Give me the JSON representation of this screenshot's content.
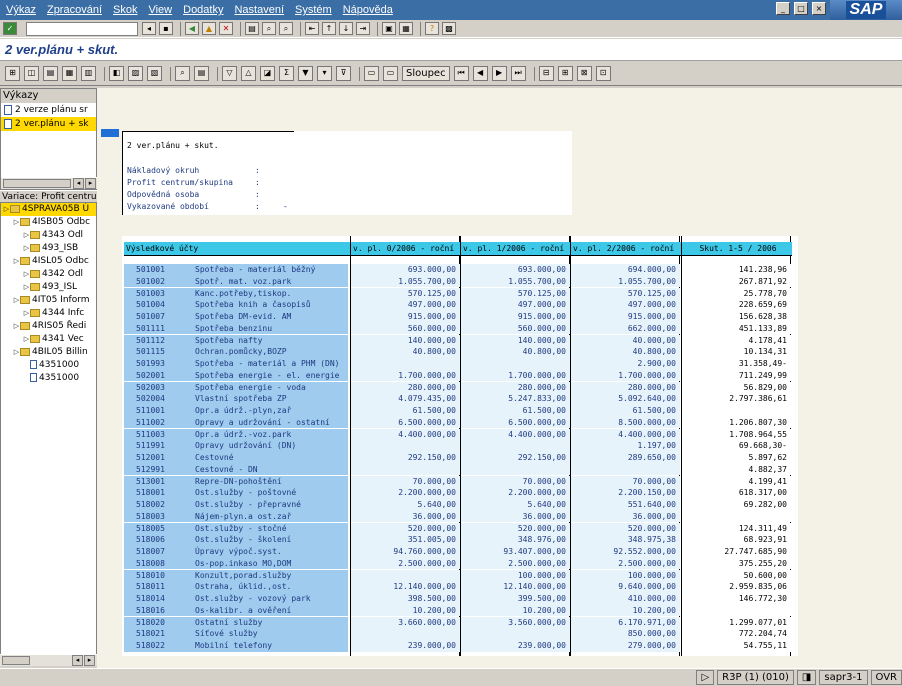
{
  "menu": [
    "Výkaz",
    "Zpracování",
    "Skok",
    "View",
    "Dodatky",
    "Nastavení",
    "Systém",
    "Nápověda"
  ],
  "title": "2 ver.plánu + skut.",
  "app_toolbar": {
    "column_button": "Sloupec"
  },
  "reports_panel": {
    "header": "Výkazy",
    "items": [
      "2 verze plánu sr",
      "2 ver.plánu + sk"
    ]
  },
  "variation_panel": {
    "header": "Variace: Profit centrum",
    "nodes": [
      {
        "label": "4SPRAVA05B Ú",
        "level": 0,
        "type": "folder",
        "sel": true
      },
      {
        "label": "4ISB05 Odbc",
        "level": 1,
        "type": "folder"
      },
      {
        "label": "4343 Odl",
        "level": 2,
        "type": "folder"
      },
      {
        "label": "493_ISB",
        "level": 2,
        "type": "folder"
      },
      {
        "label": "4ISL05 Odbc",
        "level": 1,
        "type": "folder"
      },
      {
        "label": "4342 Odl",
        "level": 2,
        "type": "folder"
      },
      {
        "label": "493_ISL",
        "level": 2,
        "type": "folder"
      },
      {
        "label": "4IT05 Inform",
        "level": 1,
        "type": "folder"
      },
      {
        "label": "4344 Infc",
        "level": 2,
        "type": "folder"
      },
      {
        "label": "4RIS05 Ředi",
        "level": 1,
        "type": "folder"
      },
      {
        "label": "4341 Vec",
        "level": 2,
        "type": "folder"
      },
      {
        "label": "4BIL05 Billin",
        "level": 1,
        "type": "folder"
      },
      {
        "label": "4351000",
        "level": 2,
        "type": "doc"
      },
      {
        "label": "4351000",
        "level": 2,
        "type": "doc"
      }
    ]
  },
  "report_header": {
    "title": "2 ver.plánu + skut.",
    "lines": [
      {
        "label": "Nákladový okruh",
        "colon": ":",
        "value": ""
      },
      {
        "label": "Profit centrum/skupina",
        "colon": ":",
        "value": ""
      },
      {
        "label": "Odpovědná osoba",
        "colon": ":",
        "value": ""
      },
      {
        "label": "Vykazované období",
        "colon": ":",
        "value": "-"
      }
    ]
  },
  "table": {
    "columns": [
      "Výsledkové účty",
      "v. pl. 0/2006 - roční",
      "v. pl. 1/2006 - roční",
      "v. pl. 2/2006 - roční",
      "Skut. 1-5 / 2006"
    ],
    "rows": [
      [
        "501001",
        "Spotřeba - materiál běžný",
        "693.000,00",
        "693.000,00",
        "694.000,00",
        "141.238,96"
      ],
      [
        "501002",
        "Spotř. mat. voz.park",
        "1.055.700,00",
        "1.055.700,00",
        "1.055.700,00",
        "267.871,92"
      ],
      [
        "501003",
        "Kanc.potřeby,tiskop.",
        "570.125,00",
        "570.125,00",
        "570.125,00",
        "25.778,70"
      ],
      [
        "501004",
        "Spotřeba knih a časopisů",
        "497.000,00",
        "497.000,00",
        "497.000,00",
        "228.659,69"
      ],
      [
        "501007",
        "Spotřeba DM-evid. AM",
        "915.000,00",
        "915.000,00",
        "915.000,00",
        "156.628,38"
      ],
      [
        "501111",
        "Spotřeba benzinu",
        "560.000,00",
        "560.000,00",
        "662.000,00",
        "451.133,89"
      ],
      [
        "501112",
        "Spotřeba nafty",
        "140.000,00",
        "140.000,00",
        "40.000,00",
        "4.178,41"
      ],
      [
        "501115",
        "Ochran.pomůcky,BOZP",
        "40.800,00",
        "40.800,00",
        "40.800,00",
        "10.134,31"
      ],
      [
        "501993",
        "Spotřeba - materiál a PHM (DN)",
        "",
        "",
        "2.900,00",
        "31.358,49-"
      ],
      [
        "502001",
        "Spotřeba energie - el. energie",
        "1.700.000,00",
        "1.700.000,00",
        "1.700.000,00",
        "711.249,99"
      ],
      [
        "502003",
        "Spotřeba energie - voda",
        "280.000,00",
        "280.000,00",
        "280.000,00",
        "56.829,00"
      ],
      [
        "502004",
        "Vlastní spotřeba ZP",
        "4.079.435,00",
        "5.247.833,00",
        "5.092.640,00",
        "2.797.386,61"
      ],
      [
        "511001",
        "Opr.a údrž.-plyn,zař",
        "61.500,00",
        "61.500,00",
        "61.500,00",
        ""
      ],
      [
        "511002",
        "Opravy a udržování - ostatní",
        "6.500.000,00",
        "6.500.000,00",
        "8.500.000,00",
        "1.206.807,30"
      ],
      [
        "511003",
        "Opr.a údrž.-voz.park",
        "4.400.000,00",
        "4.400.000,00",
        "4.400.000,00",
        "1.708.964,55"
      ],
      [
        "511991",
        "Opravy udržování (DN)",
        "",
        "",
        "1.197,00",
        "69.668,30-"
      ],
      [
        "512001",
        "Cestovné",
        "292.150,00",
        "292.150,00",
        "289.650,00",
        "5.897,62"
      ],
      [
        "512991",
        "Cestovné - DN",
        "",
        "",
        "",
        "4.882,37"
      ],
      [
        "513001",
        "Repre-DN-pohoštění",
        "70.000,00",
        "70.000,00",
        "70.000,00",
        "4.199,41"
      ],
      [
        "518001",
        "Ost.služby - poštovné",
        "2.200.000,00",
        "2.200.000,00",
        "2.200.150,00",
        "618.317,00"
      ],
      [
        "518002",
        "Ost.služby - přepravné",
        "5.640,00",
        "5.640,00",
        "551.640,00",
        "69.282,00"
      ],
      [
        "518003",
        "Nájem-plyn.a ost.zař",
        "36.000,00",
        "36.000,00",
        "36.000,00",
        ""
      ],
      [
        "518005",
        "Ost.služby - stočné",
        "520.000,00",
        "520.000,00",
        "520.000,00",
        "124.311,49"
      ],
      [
        "518006",
        "Ost.služby - školení",
        "351.005,00",
        "348.976,00",
        "348.975,38",
        "68.923,91"
      ],
      [
        "518007",
        "Úpravy výpoč.syst.",
        "94.760.000,00",
        "93.407.000,00",
        "92.552.000,00",
        "27.747.685,90"
      ],
      [
        "518008",
        "Os-pop.inkaso MO,DOM",
        "2.500.000,00",
        "2.500.000,00",
        "2.500.000,00",
        "375.255,20"
      ],
      [
        "518010",
        "Konzult,porad.služby",
        "",
        "100.000,00",
        "100.000,00",
        "50.600,00"
      ],
      [
        "518011",
        "Ostraha, úklid.,ost.",
        "12.140.000,00",
        "12.140.000,00",
        "9.640.000,00",
        "2.959.835,06"
      ],
      [
        "518014",
        "Ost.služby - vozový park",
        "398.500,00",
        "399.500,00",
        "410.000,00",
        "146.772,30"
      ],
      [
        "518016",
        "Os-kalibr. a ověření",
        "10.200,00",
        "10.200,00",
        "10.200,00",
        ""
      ],
      [
        "518020",
        "Ostatní služby",
        "3.660.000,00",
        "3.560.000,00",
        "6.170.971,00",
        "1.299.077,01"
      ],
      [
        "518021",
        "Síťové služby",
        "",
        "",
        "850.000,00",
        "772.204,74"
      ],
      [
        "518022",
        "Mobilní telefony",
        "239.000,00",
        "239.000,00",
        "279.000,00",
        "54.755,11"
      ]
    ]
  },
  "status": {
    "system": "R3P (1) (010)",
    "server": "sapr3-1",
    "mode": "OVR"
  }
}
